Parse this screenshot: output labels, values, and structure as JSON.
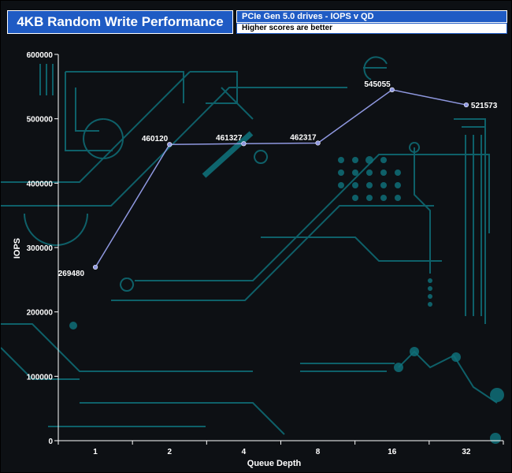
{
  "header": {
    "title": "4KB Random Write Performance",
    "subtitle": "PCIe Gen 5.0 drives - IOPS v QD",
    "note": "Higher scores are better"
  },
  "colors": {
    "line": "#8f98e0",
    "panel": "#1f5bc4",
    "background": "#0d1014",
    "circuit": "#0f6f78"
  },
  "chart_data": {
    "type": "line",
    "categories": [
      "1",
      "2",
      "4",
      "8",
      "16",
      "32"
    ],
    "series": [
      {
        "values": [
          269480,
          460120,
          461327,
          462317,
          545055,
          521573
        ]
      }
    ],
    "data_labels": [
      "269480",
      "460120",
      "461327",
      "462317",
      "545055",
      "521573"
    ],
    "xlabel": "Queue Depth",
    "ylabel": "IOPS",
    "ylim": [
      0,
      600000
    ],
    "yticks": [
      "0",
      "100000",
      "200000",
      "300000",
      "400000",
      "500000",
      "600000"
    ],
    "grid": false,
    "legend": "none"
  }
}
